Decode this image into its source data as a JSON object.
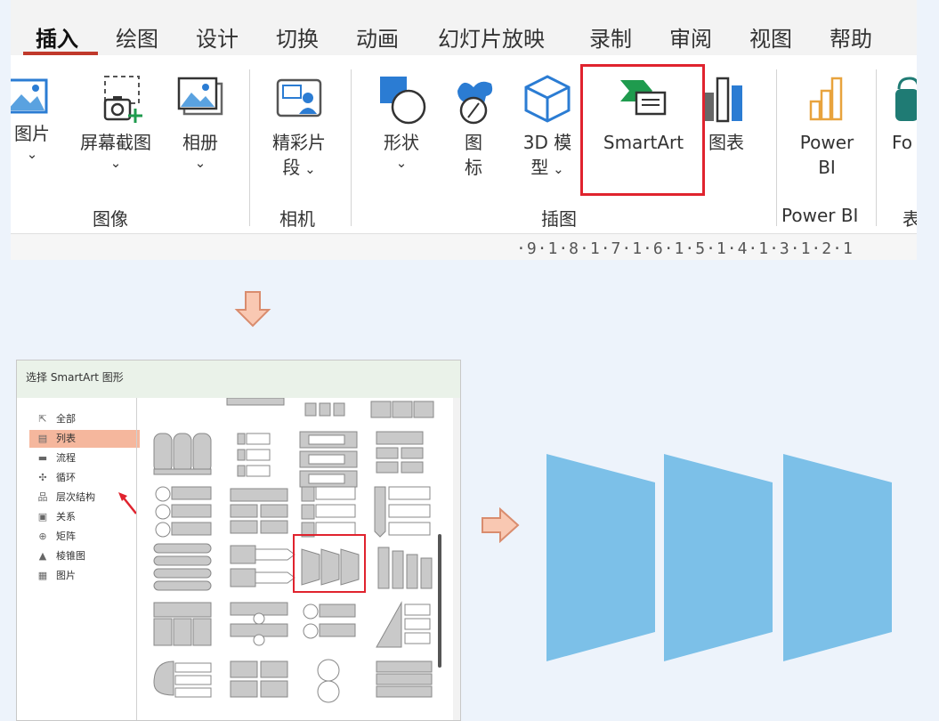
{
  "ribbon": {
    "tabs": [
      {
        "label": "插入",
        "active": true
      },
      {
        "label": "绘图"
      },
      {
        "label": "设计"
      },
      {
        "label": "切换"
      },
      {
        "label": "动画"
      },
      {
        "label": "幻灯片放映"
      },
      {
        "label": "录制"
      },
      {
        "label": "审阅"
      },
      {
        "label": "视图"
      },
      {
        "label": "帮助"
      }
    ],
    "images_group": {
      "label": "图像",
      "picture": "图片",
      "screenshot": "屏幕截图",
      "album": "相册"
    },
    "camera_group": {
      "label": "相机",
      "cameo_line1": "精彩片",
      "cameo_line2": "段"
    },
    "illustrations_group": {
      "label": "插图",
      "shapes": "形状",
      "icons_line1": "图",
      "icons_line2": "标",
      "model3d_line1": "3D 模",
      "model3d_line2": "型",
      "smartart": "SmartArt",
      "chart": "图表"
    },
    "powerbi_group": {
      "label": "Power BI",
      "button_line1": "Power",
      "button_line2": "BI"
    },
    "forms_partial": "Fo",
    "next_group_partial": "表",
    "ruler": "·9·1·8·1·7·1·6·1·5·1·4·1·3·1·2·1"
  },
  "dialog": {
    "title": "选择 SmartArt 图形",
    "categories": [
      {
        "label": "全部",
        "icon": "all-icon"
      },
      {
        "label": "列表",
        "icon": "list-icon",
        "selected": true
      },
      {
        "label": "流程",
        "icon": "process-icon"
      },
      {
        "label": "循环",
        "icon": "cycle-icon"
      },
      {
        "label": "层次结构",
        "icon": "hierarchy-icon"
      },
      {
        "label": "关系",
        "icon": "relationship-icon"
      },
      {
        "label": "矩阵",
        "icon": "matrix-icon"
      },
      {
        "label": "棱锥图",
        "icon": "pyramid-icon"
      },
      {
        "label": "图片",
        "icon": "picture-icon"
      }
    ]
  },
  "colors": {
    "accent_red": "#e0232e",
    "tab_underline": "#c0392b",
    "selected_category": "#f5b79d",
    "arrow_fill": "#f9c8b2",
    "arrow_stroke": "#d98c6e",
    "shape_blue": "#7cc0e8",
    "office_blue": "#2b7cd3",
    "office_teal": "#1f7b74",
    "powerbi_orange": "#e8a33d"
  }
}
